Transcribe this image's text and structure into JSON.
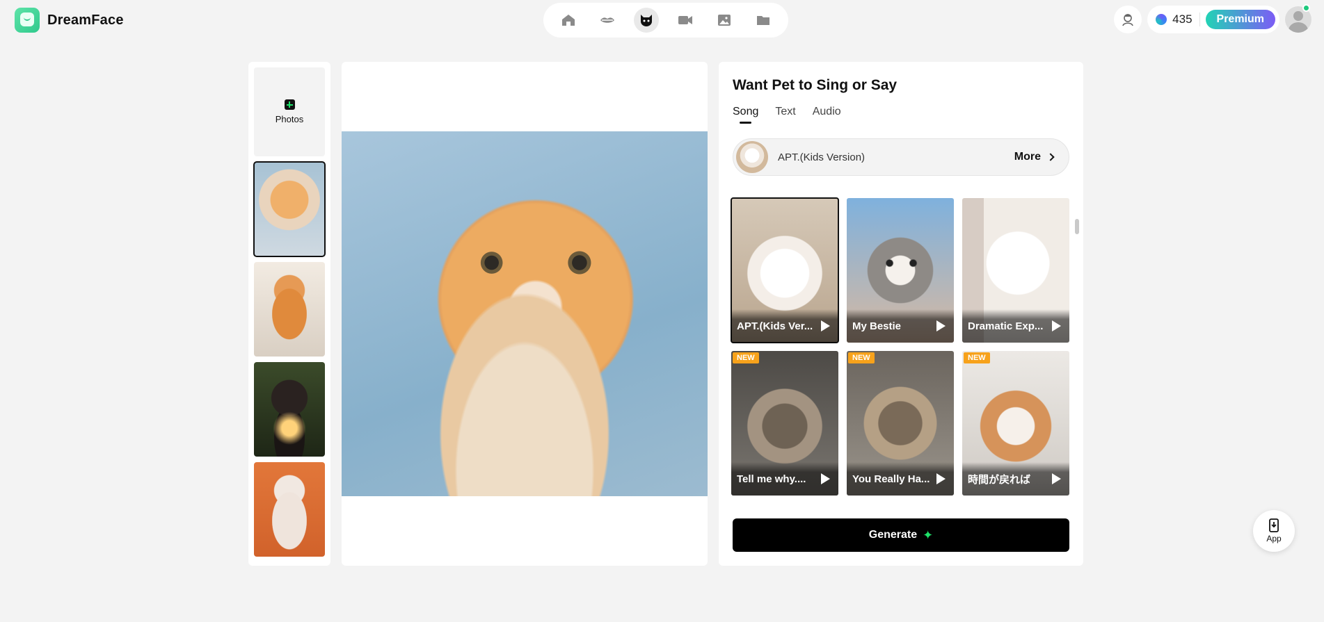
{
  "brand": {
    "name": "DreamFace"
  },
  "nav": {
    "items": [
      {
        "icon": "home-icon"
      },
      {
        "icon": "lips-icon"
      },
      {
        "icon": "cat-icon",
        "active": true
      },
      {
        "icon": "video-icon"
      },
      {
        "icon": "image-icon"
      },
      {
        "icon": "folder-icon"
      }
    ]
  },
  "header": {
    "credits": "435",
    "premium_label": "Premium"
  },
  "photos": {
    "add_label": "Photos",
    "items": [
      {
        "subject": "orange cat",
        "selected": true
      },
      {
        "subject": "chubby ginger cat"
      },
      {
        "subject": "puppy"
      },
      {
        "subject": "white fluffy cat"
      }
    ]
  },
  "panel": {
    "title": "Want Pet to Sing or Say",
    "tabs": [
      {
        "label": "Song",
        "active": true
      },
      {
        "label": "Text"
      },
      {
        "label": "Audio"
      }
    ],
    "selected_song": "APT.(Kids Version)",
    "more_label": "More",
    "songs": [
      {
        "label": "APT.(Kids Ver...",
        "badge": "",
        "selected": true
      },
      {
        "label": "My Bestie",
        "badge": ""
      },
      {
        "label": "Dramatic Exp...",
        "badge": ""
      },
      {
        "label": "Tell me why....",
        "badge": "NEW"
      },
      {
        "label": "You Really Ha...",
        "badge": "NEW"
      },
      {
        "label": "時間が戻れば",
        "badge": "NEW"
      }
    ],
    "generate_label": "Generate"
  },
  "app_button": {
    "label": "App"
  }
}
